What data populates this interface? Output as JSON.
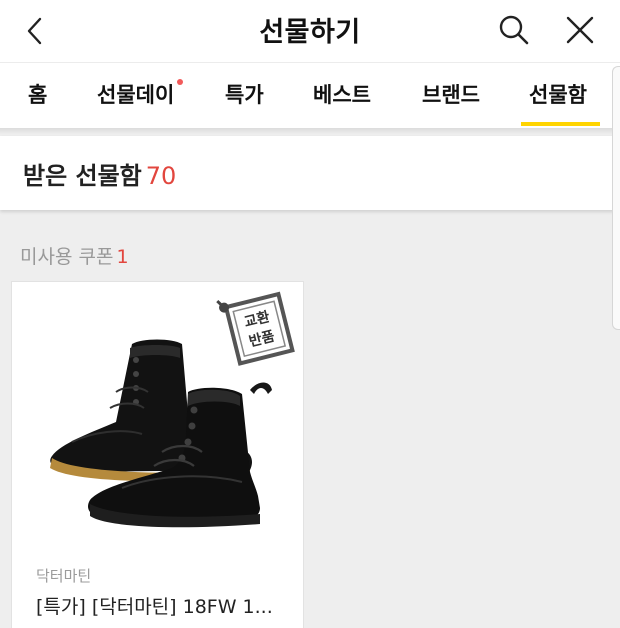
{
  "header": {
    "title": "선물하기",
    "back_icon": "chevron-left-icon",
    "search_icon": "search-icon",
    "close_icon": "close-icon"
  },
  "tabs": [
    {
      "label": "홈",
      "active": false
    },
    {
      "label": "선물데이",
      "active": false,
      "has_dot": true
    },
    {
      "label": "특가",
      "active": false
    },
    {
      "label": "베스트",
      "active": false
    },
    {
      "label": "브랜드",
      "active": false
    },
    {
      "label": "선물함",
      "active": true
    }
  ],
  "summary": {
    "label": "받은 선물함",
    "count": "70"
  },
  "coupons": {
    "heading": "미사용 쿠폰",
    "count": "1"
  },
  "items": [
    {
      "brand": "닥터마틴",
      "name": "[특가] [닥터마틴] 18FW 1...",
      "badge": "교환 반품"
    }
  ],
  "colors": {
    "accent_yellow": "#ffd400",
    "count_red": "#e2463e",
    "dot_red": "#f25a5a"
  }
}
